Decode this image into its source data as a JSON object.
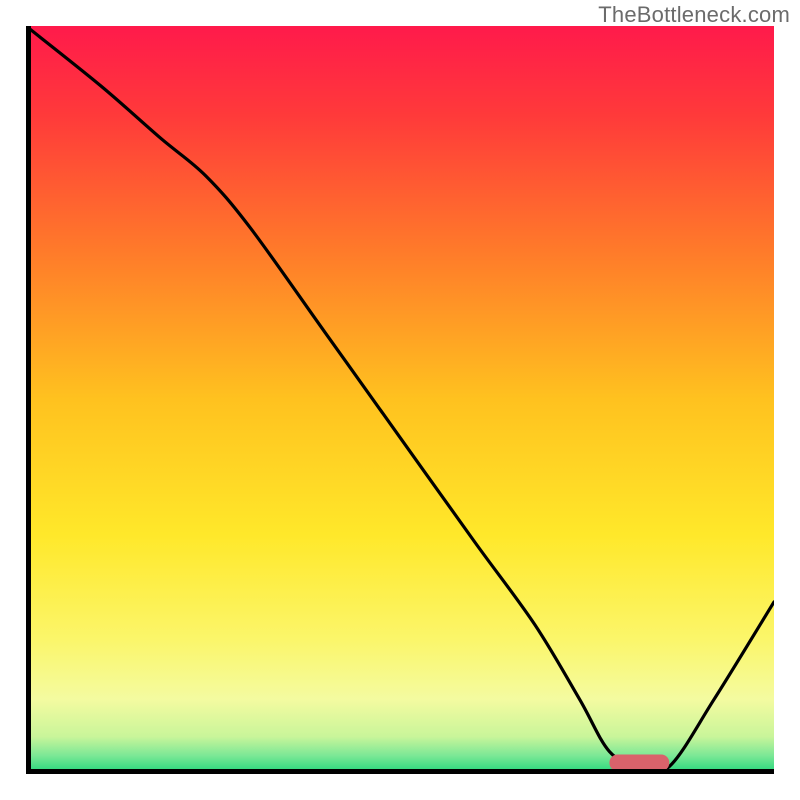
{
  "watermark": "TheBottleneck.com",
  "chart_data": {
    "type": "line",
    "title": "",
    "xlabel": "",
    "ylabel": "",
    "xlim": [
      0,
      100
    ],
    "ylim": [
      0,
      100
    ],
    "grid": false,
    "legend": false,
    "background_gradient_stops": [
      {
        "offset": 0.0,
        "color": "#ff1a4b"
      },
      {
        "offset": 0.12,
        "color": "#ff3a3a"
      },
      {
        "offset": 0.3,
        "color": "#ff7a2a"
      },
      {
        "offset": 0.5,
        "color": "#ffc21f"
      },
      {
        "offset": 0.68,
        "color": "#ffe82a"
      },
      {
        "offset": 0.82,
        "color": "#fbf66a"
      },
      {
        "offset": 0.9,
        "color": "#f4fba0"
      },
      {
        "offset": 0.95,
        "color": "#c9f59a"
      },
      {
        "offset": 0.975,
        "color": "#7de896"
      },
      {
        "offset": 1.0,
        "color": "#1fd67a"
      }
    ],
    "series": [
      {
        "name": "bottleneck-curve",
        "color": "#000000",
        "x": [
          0,
          10,
          18,
          24,
          30,
          40,
          50,
          60,
          68,
          74,
          78,
          82,
          86,
          92,
          100
        ],
        "y": [
          100,
          92,
          85,
          80,
          73,
          59,
          45,
          31,
          20,
          10,
          3,
          1,
          1,
          10,
          23
        ]
      }
    ],
    "marker": {
      "name": "optimal-range-marker",
      "color": "#d9626b",
      "x_start": 78,
      "x_end": 86,
      "y": 1.5,
      "thickness_pct": 2.2
    }
  }
}
